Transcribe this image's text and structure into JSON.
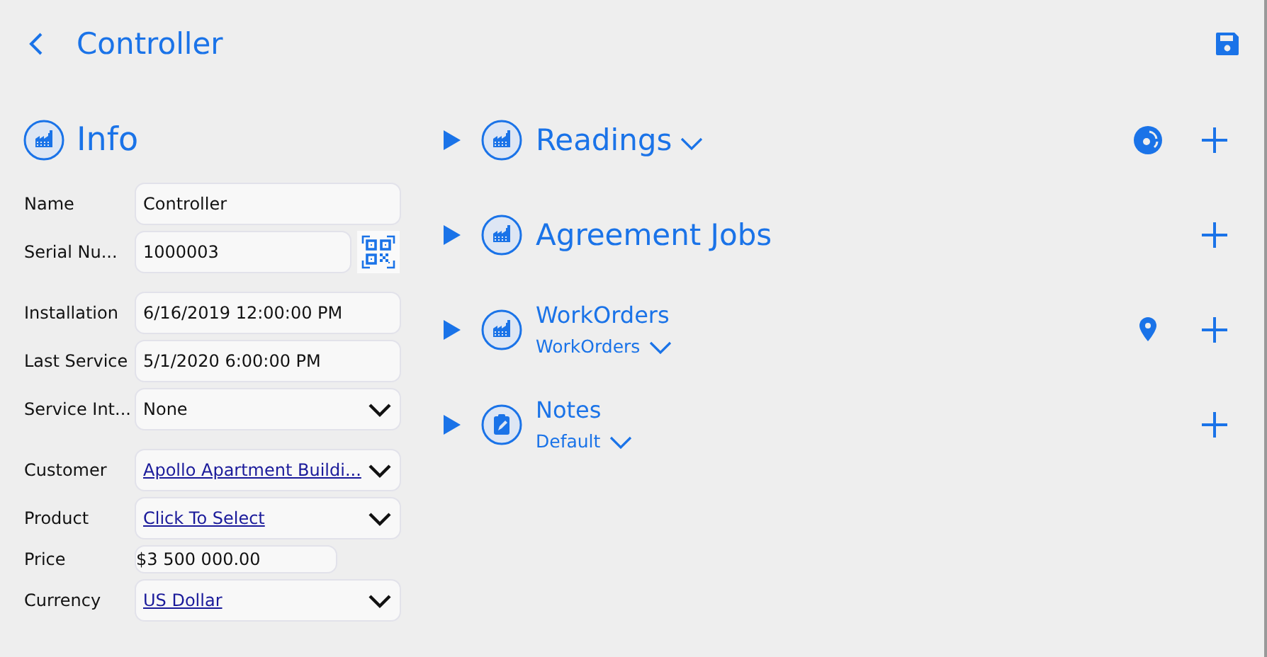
{
  "header": {
    "title": "Controller"
  },
  "info": {
    "title": "Info",
    "groups": [
      [
        {
          "label": "Name",
          "kind": "text",
          "value": "Controller"
        },
        {
          "label": "Serial Nu...",
          "kind": "scan",
          "value": "1000003"
        }
      ],
      [
        {
          "label": "Installation",
          "kind": "text",
          "value": "6/16/2019 12:00:00 PM"
        },
        {
          "label": "Last Service",
          "kind": "text",
          "value": "5/1/2020 6:00:00 PM"
        },
        {
          "label": "Service Int...",
          "kind": "select",
          "value": "None"
        }
      ],
      [
        {
          "label": "Customer",
          "kind": "link-select",
          "value": "Apollo Apartment Buildi..."
        },
        {
          "label": "Product",
          "kind": "link-select",
          "value": "Click To Select"
        },
        {
          "label": "Price",
          "kind": "readonly",
          "value": "$3 500 000.00"
        },
        {
          "label": "Currency",
          "kind": "link-select",
          "value": "US Dollar"
        }
      ]
    ]
  },
  "sections": [
    {
      "title": "Readings",
      "kind": "dropdown",
      "actions": [
        {
          "kind": "chart"
        },
        {
          "kind": "add"
        }
      ]
    },
    {
      "title": "Agreement Jobs",
      "kind": "plain",
      "actions": [
        {
          "kind": "add"
        }
      ]
    },
    {
      "title": "WorkOrders",
      "kind": "subtitled",
      "subtitle": "WorkOrders",
      "actions": [
        {
          "kind": "map"
        },
        {
          "kind": "add"
        }
      ]
    },
    {
      "title": "Notes",
      "kind": "subtitled",
      "subtitle": "Default",
      "actions": [
        {
          "kind": "add"
        }
      ]
    }
  ]
}
